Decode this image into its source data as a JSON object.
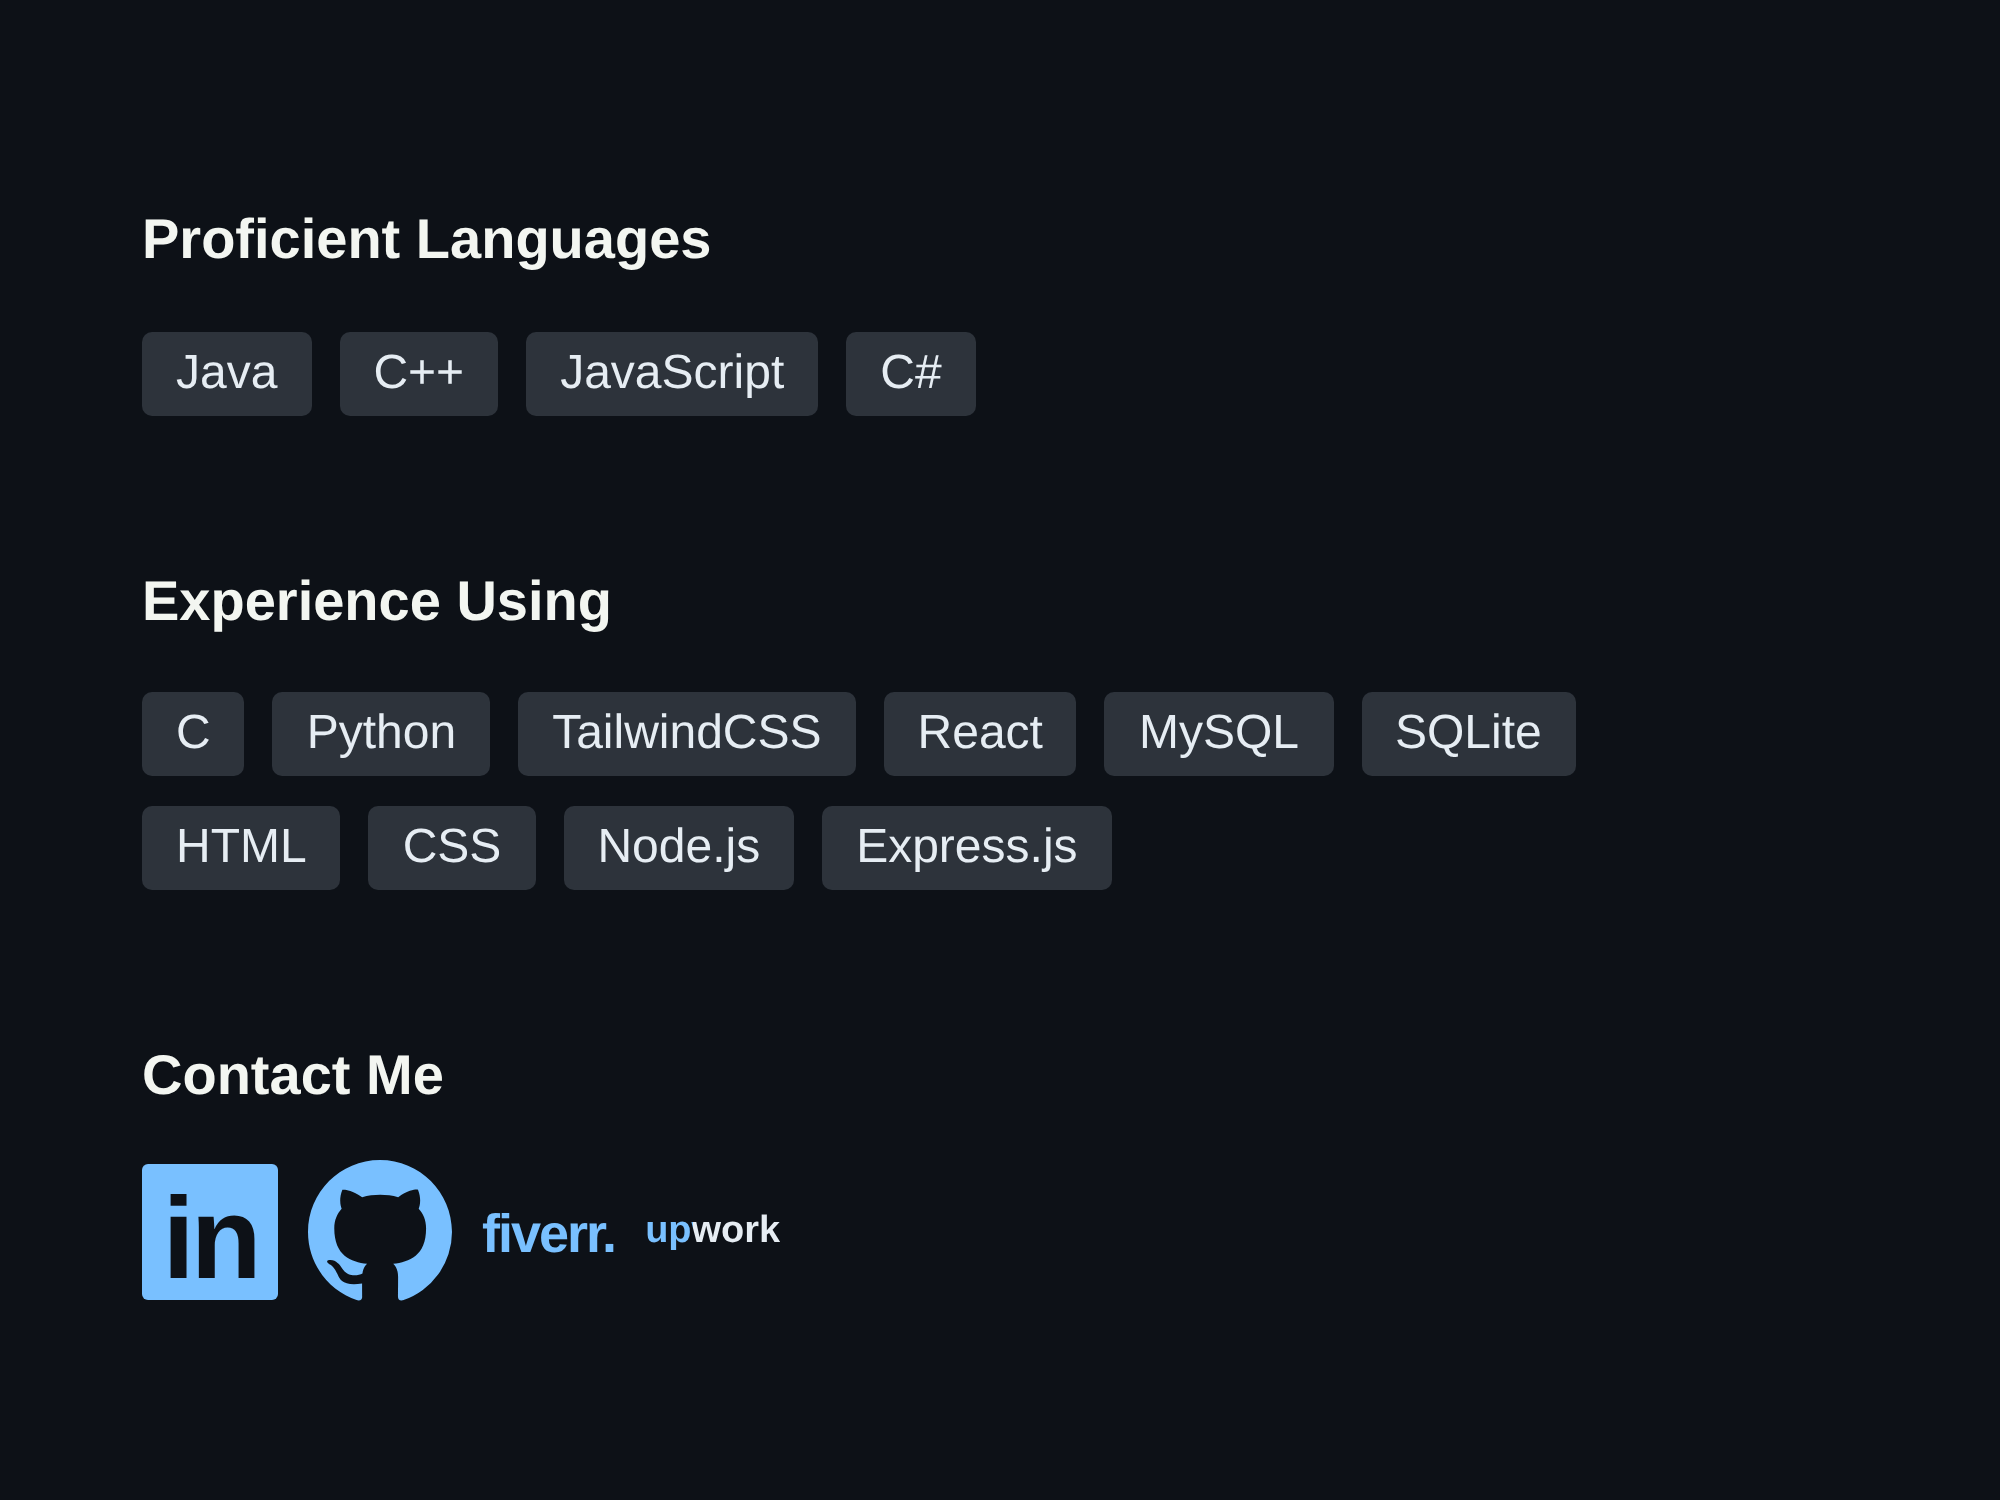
{
  "sections": [
    {
      "kind": "tags",
      "title": "Proficient Languages",
      "tags": [
        "Java",
        "C++",
        "JavaScript",
        "C#"
      ]
    },
    {
      "kind": "tags",
      "title": "Experience Using",
      "tags": [
        "C",
        "Python",
        "TailwindCSS",
        "React",
        "MySQL",
        "SQLite",
        "HTML",
        "CSS",
        "Node.js",
        "Express.js"
      ]
    },
    {
      "kind": "links",
      "title": "Contact Me",
      "links": [
        {
          "kind": "linkedin",
          "label": "in"
        },
        {
          "kind": "github"
        },
        {
          "kind": "fiverr",
          "label": "fiverr."
        },
        {
          "kind": "upwork",
          "label": "upwork"
        }
      ]
    }
  ]
}
